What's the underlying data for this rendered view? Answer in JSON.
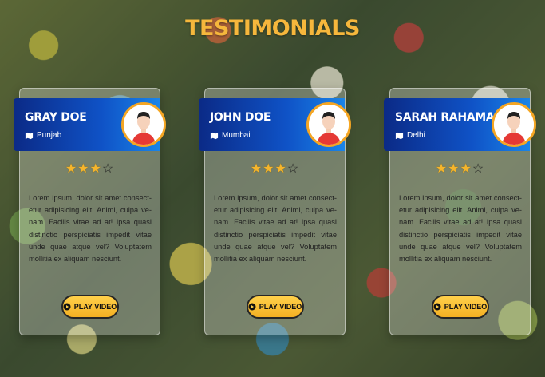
{
  "page": {
    "title": "TESTIMONIALS"
  },
  "testimonials": [
    {
      "name": "GRAY DOE",
      "location": "Punjab",
      "rating": 3,
      "max_rating": 4,
      "text": "Lorem ipsum, dolor sit amet consect- etur adipisicing elit. Animi, culpa ve- nam. Facilis vitae ad at! Ipsa quasi distinctio perspiciatis impedit vitae unde quae atque vel? Voluptatem mollitia ex aliquam nesciunt.",
      "button_label": "PLAY VIDEO",
      "icons": {
        "location": "map-icon",
        "avatar": "user-avatar-icon",
        "button": "play-circle-icon"
      }
    },
    {
      "name": "JOHN DOE",
      "location": "Mumbai",
      "rating": 3,
      "max_rating": 4,
      "text": "Lorem ipsum, dolor sit amet consect- etur adipisicing elit. Animi, culpa ve- nam. Facilis vitae ad at! Ipsa quasi distinctio perspiciatis impedit vitae unde quae atque vel? Voluptatem mollitia ex aliquam nesciunt.",
      "button_label": "PLAY VIDEO",
      "icons": {
        "location": "map-icon",
        "avatar": "user-avatar-icon",
        "button": "play-circle-icon"
      }
    },
    {
      "name": "SARAH RAHAMAN",
      "location": "Delhi",
      "rating": 3,
      "max_rating": 4,
      "text": "Lorem ipsum, dolor sit amet consect- etur adipisicing elit. Animi, culpa ve- nam. Facilis vitae ad at! Ipsa quasi distinctio perspiciatis impedit vitae unde quae atque vel? Voluptatem mollitia ex aliquam nesciunt.",
      "button_label": "PLAY VIDEO",
      "icons": {
        "location": "map-icon",
        "avatar": "user-avatar-icon",
        "button": "play-circle-icon"
      }
    }
  ],
  "colors": {
    "title": "#f6b73c",
    "header_dark": "#0b2a86",
    "header_light": "#1a84e8",
    "accent": "#f5a623",
    "button": "#ffd04a"
  }
}
